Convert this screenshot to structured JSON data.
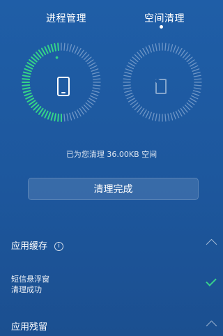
{
  "tabs": {
    "left": "进程管理",
    "right": "空间清理"
  },
  "status": {
    "text": "已为您清理 36.00KB 空间"
  },
  "action": {
    "done_label": "清理完成"
  },
  "sections": [
    {
      "title": "应用缓存",
      "items": [
        {
          "name": "短信悬浮窗",
          "result": "清理成功"
        }
      ]
    },
    {
      "title": "应用残留"
    }
  ],
  "colors": {
    "ring_active": "#35d389",
    "ring_inactive": "#9bb7db",
    "check_color": "#39d18b"
  },
  "icons": {
    "left_ring": "phone-icon",
    "right_ring": "sd-card-icon"
  }
}
